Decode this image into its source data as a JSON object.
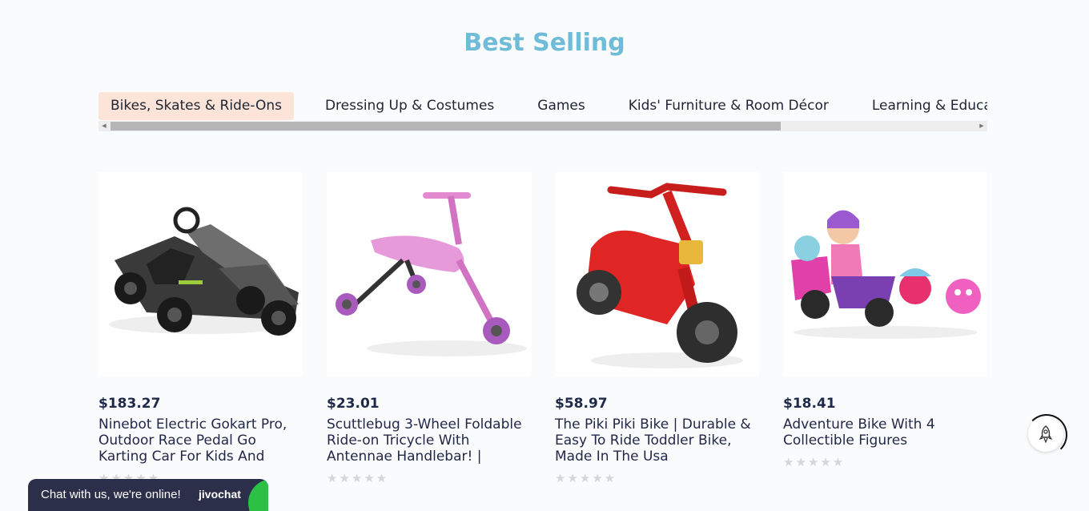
{
  "section": {
    "title": "Best Selling"
  },
  "tabs": [
    {
      "label": "Bikes, Skates & Ride-Ons",
      "active": true
    },
    {
      "label": "Dressing Up & Costumes",
      "active": false
    },
    {
      "label": "Games",
      "active": false
    },
    {
      "label": "Kids' Furniture & Room Décor",
      "active": false
    },
    {
      "label": "Learning & Education",
      "active": false
    }
  ],
  "products": [
    {
      "price": "$183.27",
      "name": "Ninebot Electric Gokart Pro, Outdoor Race Pedal Go Karting Car For Kids And",
      "image": "gokart",
      "rating": 0
    },
    {
      "price": "$23.01",
      "name": "Scuttlebug 3-Wheel Foldable Ride-on Tricycle With Antennae Handlebar! |",
      "image": "tricycle",
      "rating": 0
    },
    {
      "price": "$58.97",
      "name": "The Piki Piki Bike | Durable & Easy To Ride Toddler Bike, Made In The Usa",
      "image": "red-bike",
      "rating": 0
    },
    {
      "price": "$18.41",
      "name": "Adventure Bike With 4 Collectible Figures",
      "image": "figures-bike",
      "rating": 0
    }
  ],
  "chat": {
    "text": "Chat with us, we're online!",
    "brand": "jivochat"
  },
  "colors": {
    "title": "#6fbcd9",
    "active_tab": "#fde4d8",
    "chat_bg": "#2c2f49",
    "chat_accent": "#2cc046"
  }
}
